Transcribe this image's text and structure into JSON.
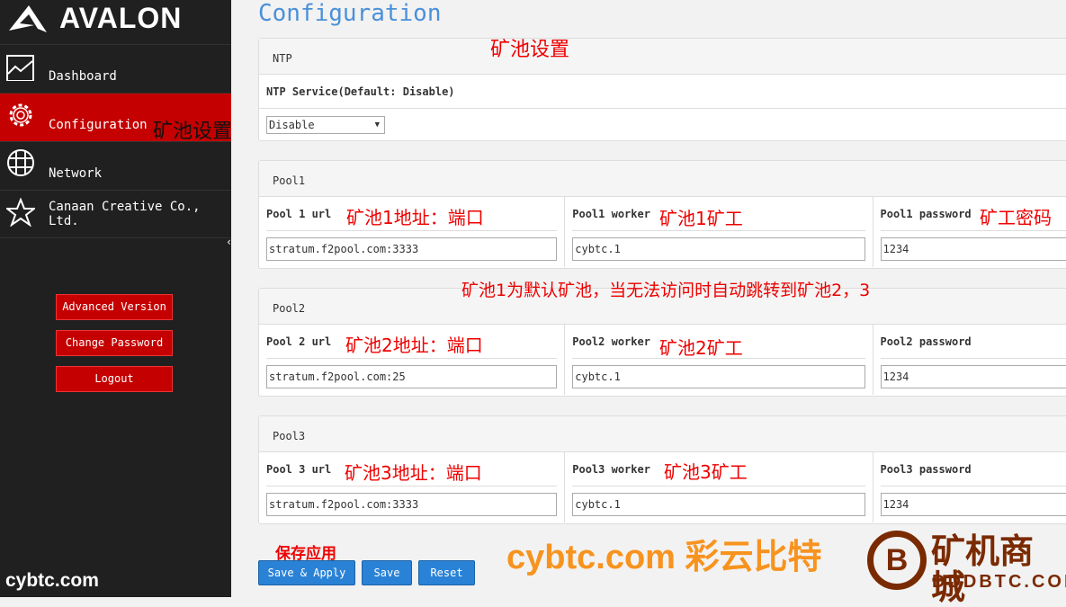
{
  "brand": {
    "name": "AVALON"
  },
  "sidebar": {
    "items": [
      {
        "label": "Dashboard",
        "icon": "chart-line-icon"
      },
      {
        "label": "Configuration",
        "icon": "gear-icon",
        "active": true
      },
      {
        "label": "Network",
        "icon": "globe-icon"
      },
      {
        "label": "Canaan Creative Co., Ltd.",
        "icon": "star-icon"
      }
    ],
    "buttons": {
      "advanced": "Advanced Version",
      "change_password": "Change Password",
      "logout": "Logout"
    }
  },
  "main": {
    "title": "Configuration",
    "ntp": {
      "header": "NTP",
      "label": "NTP Service(Default: Disable)",
      "value": "Disable"
    },
    "pools": [
      {
        "header": "Pool1",
        "url_label": "Pool 1 url",
        "worker_label": "Pool1 worker",
        "password_label": "Pool1 password",
        "url": "stratum.f2pool.com:3333",
        "worker": "cybtc.1",
        "password": "1234"
      },
      {
        "header": "Pool2",
        "url_label": "Pool 2 url",
        "worker_label": "Pool2 worker",
        "password_label": "Pool2 password",
        "url": "stratum.f2pool.com:25",
        "worker": "cybtc.1",
        "password": "1234"
      },
      {
        "header": "Pool3",
        "url_label": "Pool 3 url",
        "worker_label": "Pool3 worker",
        "password_label": "Pool3 password",
        "url": "stratum.f2pool.com:3333",
        "worker": "cybtc.1",
        "password": "1234"
      }
    ],
    "buttons": {
      "save_apply": "Save & Apply",
      "save": "Save",
      "reset": "Reset"
    }
  },
  "annotations": {
    "config_side": "矿池设置",
    "config_top": "矿池设置",
    "p1url": "矿池1地址：端口",
    "p1worker": "矿池1矿工",
    "p1pass": "矿工密码",
    "note": "矿池1为默认矿池，当无法访问时自动跳转到矿池2，3",
    "p2url": "矿池2地址：端口",
    "p2worker": "矿池2矿工",
    "p3url": "矿池3地址：端口",
    "p3worker": "矿池3矿工",
    "save": "保存应用"
  },
  "watermarks": {
    "left": "cybtc.com",
    "center": "cybtc.com 彩云比特",
    "right_top": "矿机商城",
    "right_bottom": "DDDBTC.COM"
  },
  "colors": {
    "sidebar": "#202020",
    "active": "#c40000",
    "accent": "#2a82d6",
    "annotation": "#e00000"
  }
}
